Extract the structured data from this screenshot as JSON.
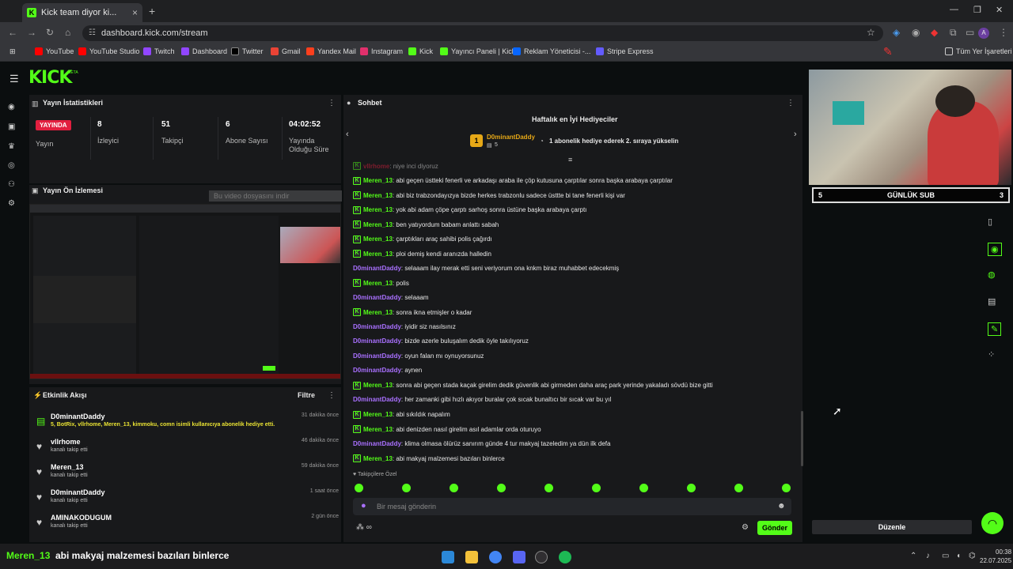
{
  "browser": {
    "tab_title": "Kick team diyor ki...",
    "url": "dashboard.kick.com/stream",
    "bookmarks": [
      "YouTube",
      "YouTube Studio",
      "Twitch",
      "Dashboard",
      "Twitter",
      "Gmail",
      "Yandex Mail",
      "Instagram",
      "Kick",
      "Yayıncı Paneli | Kick",
      "Reklam Yöneticisi -...",
      "Stripe Express"
    ],
    "bookmarks_folder": "Tüm Yer İşaretleri"
  },
  "kick": {
    "logo": "KICK",
    "beta": "BETA"
  },
  "stats": {
    "title": "Yayın İstatistikleri",
    "live_badge": "YAYINDA",
    "live_label": "Yayın",
    "viewers_value": "8",
    "viewers_label": "İzleyici",
    "followers_value": "51",
    "followers_label": "Takipçi",
    "subs_value": "6",
    "subs_label": "Abone Sayısı",
    "duration_value": "04:02:52",
    "duration_label_1": "Yayında",
    "duration_label_2": "Olduğu Süre"
  },
  "preview": {
    "title": "Yayın Ön İzlemesi",
    "download": "Bu video dosyasını indir"
  },
  "activity": {
    "title": "Etkinlik Akışı",
    "filter": "Filtre",
    "items": [
      {
        "name": "D0minantDaddy",
        "sub": "5, BotRix, vllrhome, Meren_13, kimmoku, comn isimli kullanıcıya abonelik hediye etti.",
        "time": "31 dakika önce"
      },
      {
        "name": "vllrhome",
        "sub": "kanalı takip etti",
        "time": "46 dakika önce"
      },
      {
        "name": "Meren_13",
        "sub": "kanalı takip etti",
        "time": "59 dakika önce"
      },
      {
        "name": "D0minantDaddy",
        "sub": "kanalı takip etti",
        "time": "1 saat önce"
      },
      {
        "name": "AMINAKODUGUM",
        "sub": "kanalı takip etti",
        "time": "2 gün önce"
      }
    ]
  },
  "chat": {
    "title": "Sohbet",
    "leaderboard_title": "Haftalık en İyi Hediyeciler",
    "leader_rank": "1",
    "leader_name": "D0minantDaddy",
    "leader_count": "5",
    "leader_hint": "1 abonelik hediye ederek 2. sıraya yükselin",
    "messages": [
      {
        "user": "vllrhome",
        "color": "red",
        "text": ": niye inci diyoruz",
        "badge": true
      },
      {
        "user": "Meren_13",
        "color": "green",
        "text": ": abi geçen üstteki fenerli ve arkadaşı araba ile çöp kutusuna çarptılar sonra başka arabaya çarptılar",
        "badge": true
      },
      {
        "user": "Meren_13",
        "color": "green",
        "text": ": abi biz trabzondayızya bizde herkes trabzonlu sadece üsttte bi tane fenerli kişi var",
        "badge": true
      },
      {
        "user": "Meren_13",
        "color": "green",
        "text": ": yok abi adam çöpe çarptı sarhoş sonra üstüne başka arabaya çarptı",
        "badge": true
      },
      {
        "user": "Meren_13",
        "color": "green",
        "text": ": ben yatıyordum babam anlattı sabah",
        "badge": true
      },
      {
        "user": "Meren_13",
        "color": "green",
        "text": ": çarptıkları araç sahibi polis çağırdı",
        "badge": true
      },
      {
        "user": "Meren_13",
        "color": "green",
        "text": ": ploi demiş kendi aranızda halledin",
        "badge": true
      },
      {
        "user": "D0minantDaddy",
        "color": "purple",
        "text": ": selaaam ilay merak etti seni veriyorum ona knkm biraz muhabbet edecekmiş",
        "badge": false
      },
      {
        "user": "Meren_13",
        "color": "green",
        "text": ": polis",
        "badge": true
      },
      {
        "user": "D0minantDaddy",
        "color": "purple",
        "text": ": selaaam",
        "badge": false
      },
      {
        "user": "Meren_13",
        "color": "green",
        "text": ": sonra ikna etmişler o kadar",
        "badge": true
      },
      {
        "user": "D0minantDaddy",
        "color": "purple",
        "text": ": iyidir siz nasılsınız",
        "badge": false
      },
      {
        "user": "D0minantDaddy",
        "color": "purple",
        "text": ": bizde azerle buluşalım dedik öyle takılıyoruz",
        "badge": false
      },
      {
        "user": "D0minantDaddy",
        "color": "purple",
        "text": ": oyun falan mı oynuyorsunuz",
        "badge": false
      },
      {
        "user": "D0minantDaddy",
        "color": "purple",
        "text": ": aynen",
        "badge": false
      },
      {
        "user": "Meren_13",
        "color": "green",
        "text": ": sonra abi geçen stada kaçak girelim dedik güvenlik abi girmeden daha araç park yerinde yakaladı sövdü bize gitti",
        "badge": true
      },
      {
        "user": "D0minantDaddy",
        "color": "purple",
        "text": ": her zamanki gibi hızlı akıyor buralar çok sıcak bunaltıcı bir sıcak var bu yıl",
        "badge": false
      },
      {
        "user": "Meren_13",
        "color": "green",
        "text": ": abi sıkıldık napalım",
        "badge": true
      },
      {
        "user": "Meren_13",
        "color": "green",
        "text": ": abi denizden nasıl girelim asıl adamlar orda oturuyo",
        "badge": true
      },
      {
        "user": "D0minantDaddy",
        "color": "purple",
        "text": ": klima olmasa ölürüz sanırım günde 4 tur makyaj tazeledim ya dün ilk defa",
        "badge": false
      },
      {
        "user": "Meren_13",
        "color": "green",
        "text": ": abi makyaj malzemesi bazıları binlerce",
        "badge": true
      }
    ],
    "emote_section": "Takipçilere Özel",
    "input_placeholder": "Bir mesaj gönderin",
    "send": "Gönder"
  },
  "overlay": {
    "sub_left": "5",
    "sub_title": "GÜNLÜK SUB",
    "sub_right": "3",
    "edit": "Düzenle"
  },
  "taskbar": {
    "name": "Meren_13",
    "message": "abi makyaj malzemesi bazıları binlerce",
    "time": "00:38",
    "date": "22.07.2025"
  },
  "colors": {
    "kick_green": "#53fc18",
    "purple": "#a970ff",
    "live_red": "#e21f3f"
  }
}
